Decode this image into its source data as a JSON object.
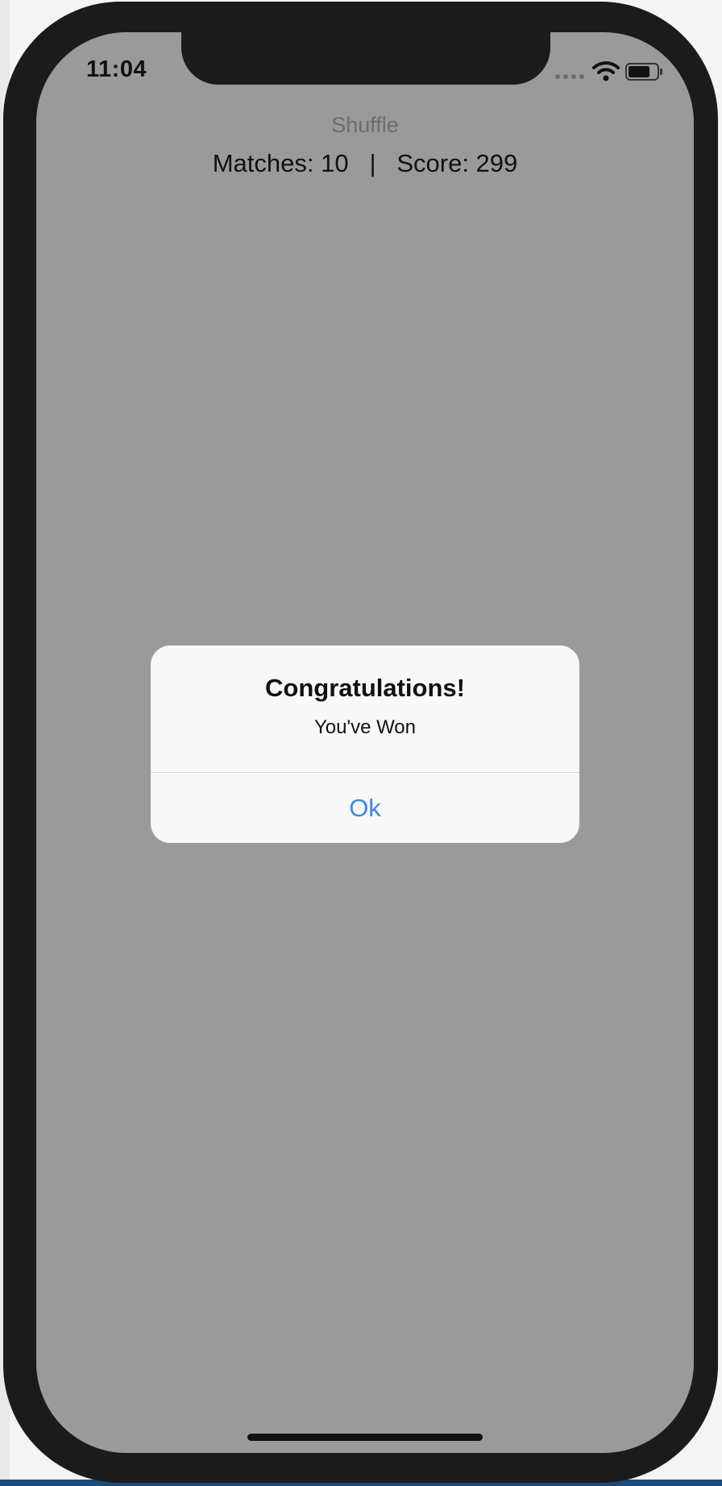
{
  "status_bar": {
    "time": "11:04",
    "icons": [
      "signal-icon",
      "wifi-icon",
      "battery-icon"
    ]
  },
  "game": {
    "title": "Shuffle",
    "matches_label": "Matches: 10",
    "separator": "|",
    "score_label": "Score: 299"
  },
  "alert": {
    "title": "Congratulations!",
    "message": "You've Won",
    "ok_label": "Ok"
  },
  "colors": {
    "screen_background": "#9a9a9a",
    "alert_background": "#f8f8f8",
    "accent": "#3f86e6",
    "device_frame": "#1b1b1b"
  }
}
